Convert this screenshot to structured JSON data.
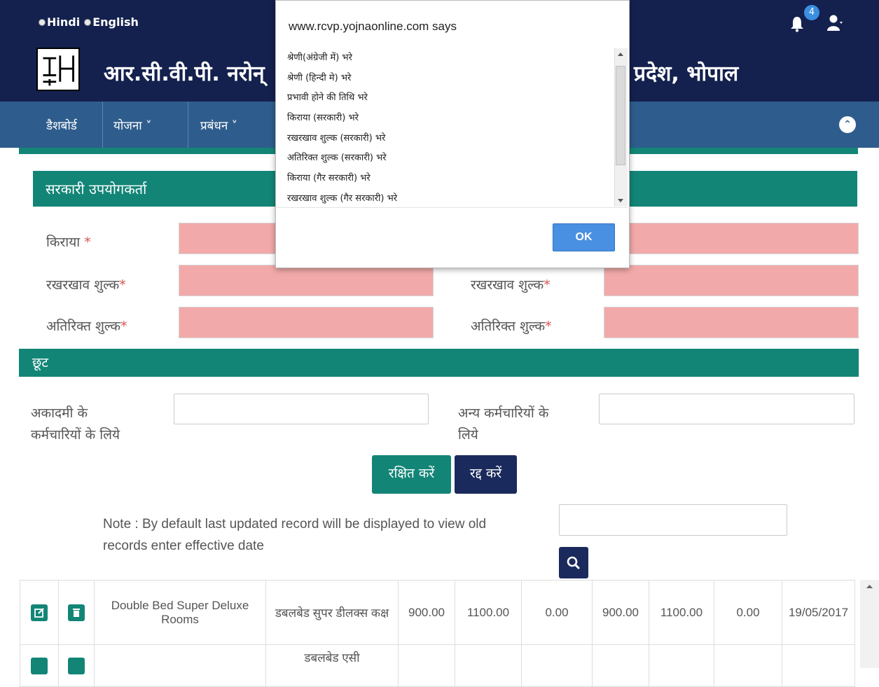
{
  "lang": {
    "hindi": "Hindi",
    "english": "English"
  },
  "notifications": {
    "count": "4"
  },
  "header": {
    "title_left": "आर.सी.वी.पी. नरोन्",
    "title_right": "प्रदेश, भोपाल"
  },
  "nav": {
    "dashboard": "डैशबोर्ड",
    "yojana": "योजना ˅",
    "prabandhan": "प्रबंधन ˅"
  },
  "section": {
    "title": "सरकारी उपयोगकर्ता"
  },
  "form": {
    "rent": "किराया",
    "maintenance": "रखरखाव शुल्क",
    "extra": "अतिरिक्त शुल्क",
    "maintenance_right": "रखरखाव शुल्क",
    "extra_right": "अतिरिक्त शुल्क",
    "required": "*"
  },
  "discount": {
    "title": "छूट",
    "academy_line1": "अकादमी के",
    "academy_line2": "कर्मचारियों के लिये",
    "others_line1": "अन्य कर्मचारियों के",
    "others_line2": "लिये"
  },
  "buttons": {
    "save": "रक्षित करें",
    "cancel": "रद्द करें"
  },
  "note": "Note : By default last updated record will be displayed to view old records enter effective date",
  "table": {
    "rows": [
      {
        "en": "Double Bed Super Deluxe Rooms",
        "hi": "डबलबेड सुपर डीलक्स कक्ष",
        "v1": "900.00",
        "v2": "1100.00",
        "v3": "0.00",
        "v4": "900.00",
        "v5": "1100.00",
        "v6": "0.00",
        "date": "19/05/2017"
      },
      {
        "en": "",
        "hi": "डबलबेड एसी",
        "v1": "",
        "v2": "",
        "v3": "",
        "v4": "",
        "v5": "",
        "v6": "",
        "date": ""
      }
    ]
  },
  "dialog": {
    "title": "www.rcvp.yojnaonline.com says",
    "lines": [
      "श्रेणी(अंग्रेजी में) भरे",
      "श्रेणी (हिन्दी मे) भरे",
      "प्रभावी होने की तिथि भरे",
      " किराया (सरकारी) भरे",
      "रखरखाव शुल्क (सरकारी) भरे",
      "अतिरिक्त शुल्क (सरकारी) भरे",
      " किराया (गैर सरकारी) भरे",
      "रखरखाव शुल्क (गैर सरकारी) भरे"
    ],
    "ok": "OK"
  },
  "colors": {
    "navy": "#14214e",
    "teal": "#138577",
    "nav_blue": "#2e5d8d",
    "pink": "#f2a9a9"
  }
}
